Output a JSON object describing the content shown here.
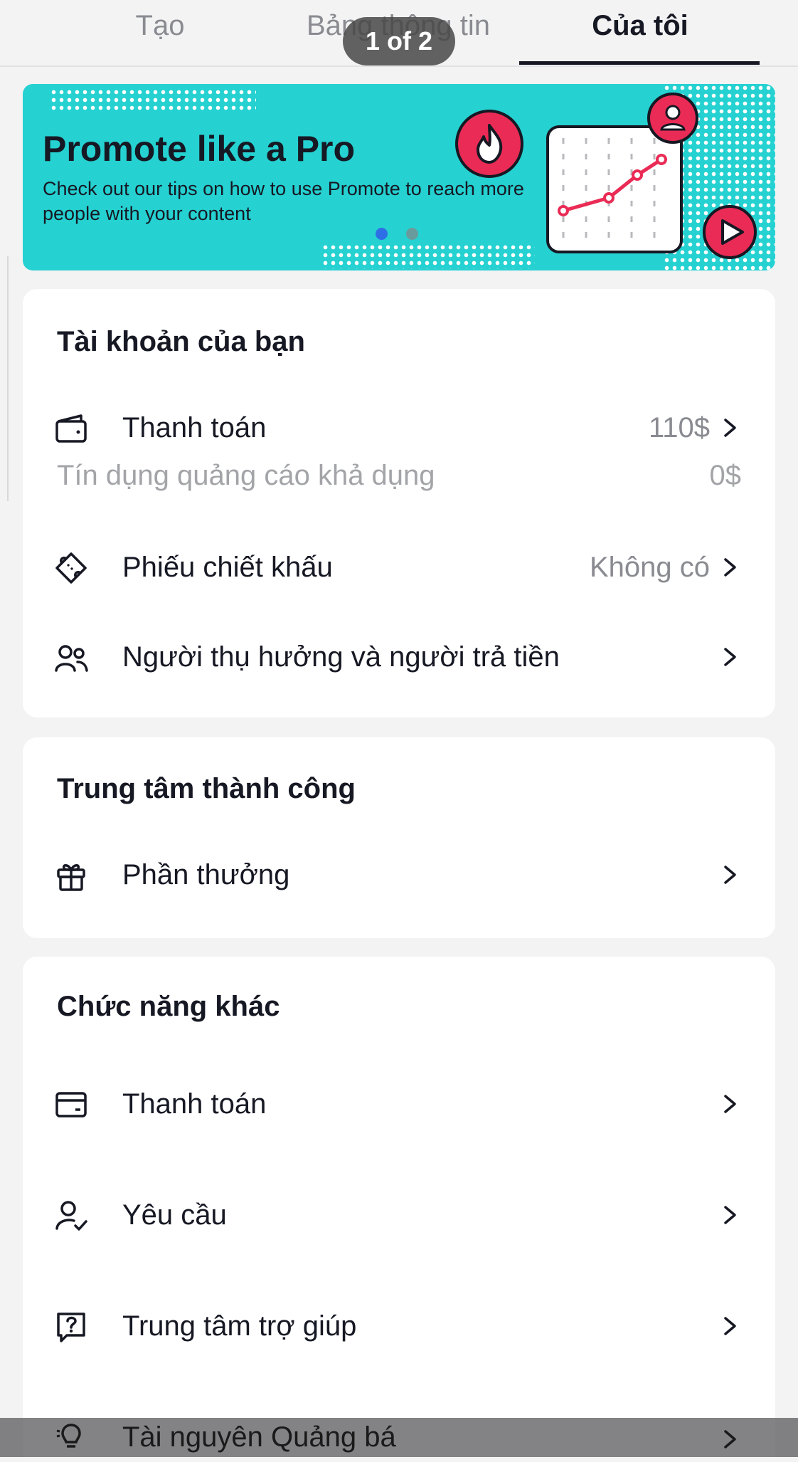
{
  "tabs": [
    {
      "label": "Tạo",
      "active": false
    },
    {
      "label": "Bảng thông tin",
      "active": false
    },
    {
      "label": "Của tôi",
      "active": true
    }
  ],
  "pager": "1 of 2",
  "banner": {
    "title": "Promote like a Pro",
    "subtitle": "Check out our tips on how to use Promote to reach more people with your content",
    "background_color": "#25d1d1",
    "accent_color": "#ea2b55",
    "carousel_index": 1,
    "carousel_total": 2
  },
  "account": {
    "title": "Tài khoản của bạn",
    "payment": {
      "label": "Thanh toán",
      "value": "110$",
      "icon": "wallet-icon"
    },
    "ad_credit": {
      "label": "Tín dụng quảng cáo khả dụng",
      "value": "0$"
    },
    "coupon": {
      "label": "Phiếu chiết khấu",
      "value": "Không có",
      "icon": "coupon-icon"
    },
    "beneficiary": {
      "label": "Người thụ hưởng và người trả tiền",
      "icon": "people-icon"
    }
  },
  "success_center": {
    "title": "Trung tâm thành công",
    "rewards": {
      "label": "Phần thưởng",
      "icon": "gift-icon"
    }
  },
  "other": {
    "title": "Chức năng khác",
    "items": [
      {
        "label": "Thanh toán",
        "icon": "card-icon"
      },
      {
        "label": "Yêu cầu",
        "icon": "user-check-icon"
      },
      {
        "label": "Trung tâm trợ giúp",
        "icon": "help-icon"
      },
      {
        "label": "Tài nguyên Quảng bá",
        "icon": "lightbulb-icon"
      }
    ]
  }
}
